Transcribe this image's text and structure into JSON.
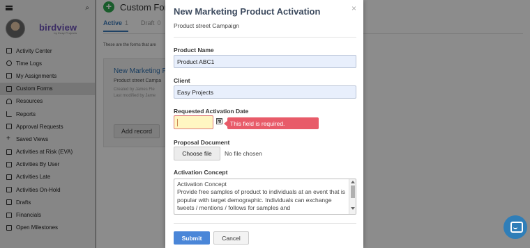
{
  "sidebar": {
    "brand": "birdview",
    "brand_tagline": "by Easy Projects",
    "items": [
      {
        "label": "Activity Center",
        "icon": "home-icon"
      },
      {
        "label": "Time Logs",
        "icon": "clock-icon"
      },
      {
        "label": "My Assignments",
        "icon": "inbox-icon"
      },
      {
        "label": "Custom Forms",
        "icon": "form-icon",
        "active": true
      },
      {
        "label": "Resources",
        "icon": "person-icon"
      },
      {
        "label": "Reports",
        "icon": "bar-chart-icon"
      },
      {
        "label": "Approval Requests",
        "icon": "chat-icon"
      },
      {
        "label": "Saved Views",
        "icon": "plus-icon"
      },
      {
        "label": "Activities at Risk (EVA)",
        "icon": "table-icon"
      },
      {
        "label": "Activities By User",
        "icon": "table-icon"
      },
      {
        "label": "Activities Late",
        "icon": "table-icon"
      },
      {
        "label": "Activities On-Hold",
        "icon": "table-icon"
      },
      {
        "label": "Drafts",
        "icon": "table-icon"
      },
      {
        "label": "Financials",
        "icon": "table-icon"
      },
      {
        "label": "Open Milestones",
        "icon": "table-icon"
      }
    ]
  },
  "main": {
    "title": "Custom Forms",
    "tabs": [
      {
        "label": "Active",
        "count": "1"
      },
      {
        "label": "Draft",
        "count": "0"
      }
    ],
    "hint": "These are the forms that are",
    "card": {
      "title": "New Marketing Pr",
      "subtitle": "Product street Campa",
      "created": "Created by James Fle",
      "modified": "Last modified by Jame"
    },
    "add_record": "Add record"
  },
  "modal": {
    "title": "New Marketing Product Activation",
    "subtitle": "Product street Campaign",
    "close": "×",
    "fields": {
      "product_name_label": "Product Name",
      "product_name_value": "Product ABC1",
      "client_label": "Client",
      "client_value": "Easy Projects",
      "date_label": "Requested Activation Date",
      "date_value": "",
      "date_error": "This field is required.",
      "document_label": "Proposal Document",
      "choose_file": "Choose file",
      "file_status": "No file chosen",
      "concept_label": "Activation Concept",
      "concept_value": "Activation Concept\nProvide free samples of product to individuals at an event that is popular with target demographic. Individuals can exchange tweets / mentions / follows for samples and"
    },
    "submit": "Submit",
    "cancel": "Cancel"
  },
  "colors": {
    "accent": "#4a86d8",
    "error": "#e85b69",
    "brand": "#6b4fb7",
    "chat": "#2f7eb8"
  }
}
